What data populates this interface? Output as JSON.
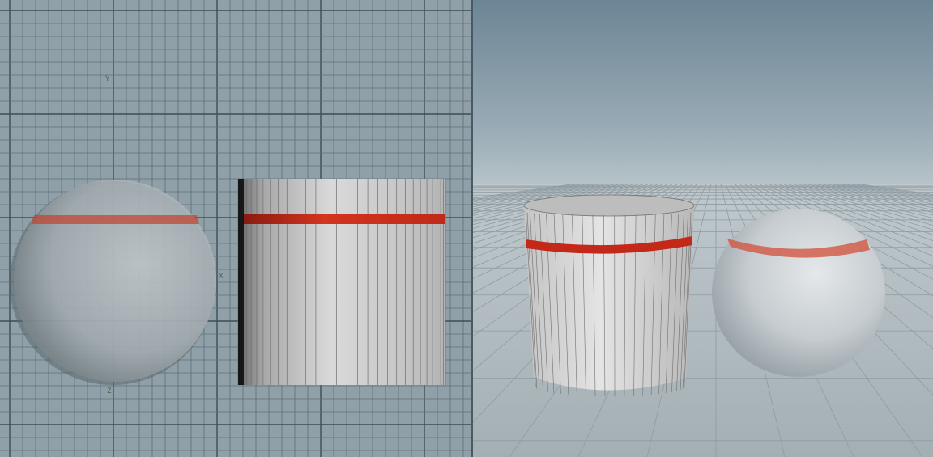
{
  "viewports": {
    "left": {
      "projection": "orthographic-front",
      "grid": true
    },
    "right": {
      "projection": "perspective",
      "grid": true
    }
  },
  "axis_labels": {
    "y": "Y",
    "x": "X",
    "z": "Z"
  },
  "colors": {
    "ortho_bg": "#90a0a8",
    "grid_line": "#4f6068",
    "persp_sky_top": "#6c8595",
    "persp_sky_bottom": "#c8d0d4",
    "ground": "#a9b3b8",
    "object_gray": "#c0c4c6",
    "band_red": "#c42818"
  },
  "objects": [
    {
      "kind": "sphere",
      "name": "sphere",
      "band": "red"
    },
    {
      "kind": "tube",
      "name": "cylinder",
      "band": "red"
    }
  ]
}
